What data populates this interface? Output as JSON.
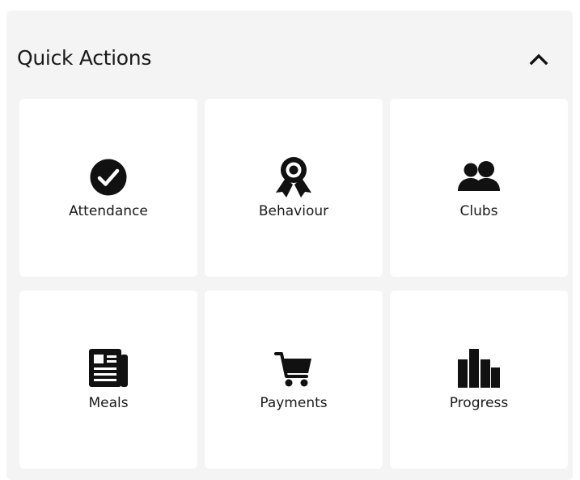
{
  "quick_actions": {
    "title": "Quick Actions",
    "collapse_icon": "chevron-up-icon",
    "items": [
      {
        "label": "Attendance",
        "icon": "check-circle-icon"
      },
      {
        "label": "Behaviour",
        "icon": "award-ribbon-icon"
      },
      {
        "label": "Clubs",
        "icon": "users-icon"
      },
      {
        "label": "Meals",
        "icon": "newspaper-icon"
      },
      {
        "label": "Payments",
        "icon": "shopping-cart-icon"
      },
      {
        "label": "Progress",
        "icon": "bar-chart-icon"
      }
    ]
  },
  "colors": {
    "panel_background": "#f4f4f4",
    "card_background": "#ffffff",
    "icon": "#111111",
    "text": "#1a1a1a"
  }
}
